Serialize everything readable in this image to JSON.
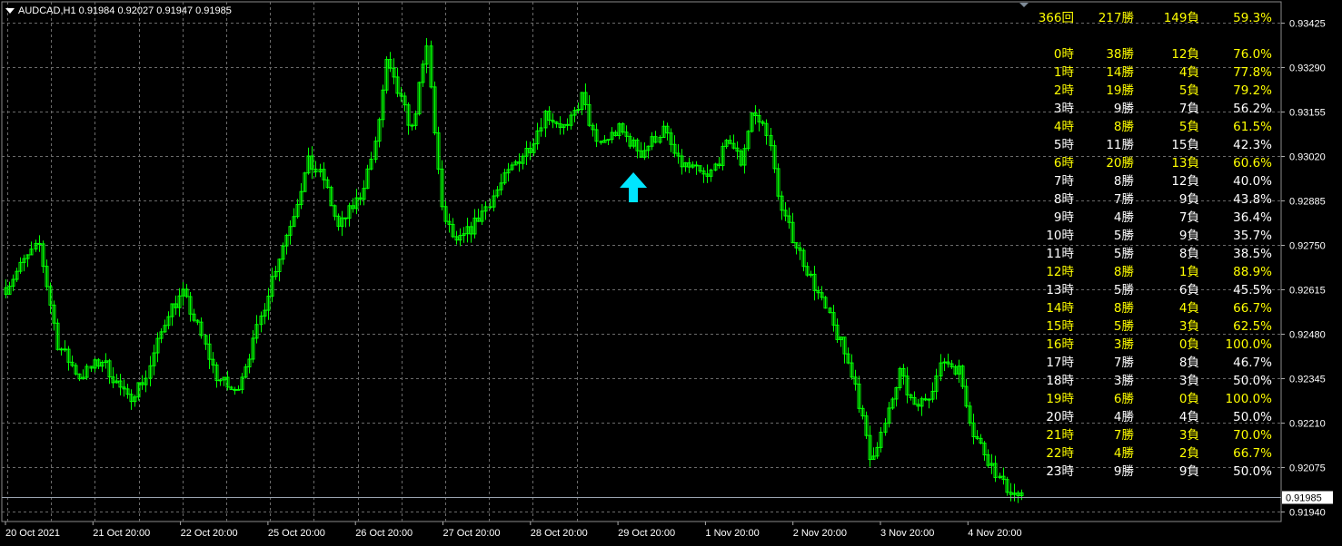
{
  "header": {
    "symbol_timeframe": "AUDCAD,H1",
    "open": "0.91984",
    "high": "0.92027",
    "low": "0.91947",
    "close": "0.91985"
  },
  "colors": {
    "background": "#000000",
    "grid": "#6b6b6b",
    "candle": "#00ff00",
    "axis_text": "#ffffff",
    "highlight_text": "#ffff00",
    "normal_text": "#ffffff",
    "arrow": "#00e5ff",
    "current_price_line": "#9aa3b0"
  },
  "summary": {
    "total": "366回",
    "wins": "217勝",
    "losses": "149負",
    "rate": "59.3%",
    "highlight": true
  },
  "hours": [
    {
      "hour": "0時",
      "wins": "38勝",
      "losses": "12負",
      "rate": "76.0%",
      "highlight": true
    },
    {
      "hour": "1時",
      "wins": "14勝",
      "losses": "4負",
      "rate": "77.8%",
      "highlight": true
    },
    {
      "hour": "2時",
      "wins": "19勝",
      "losses": "5負",
      "rate": "79.2%",
      "highlight": true
    },
    {
      "hour": "3時",
      "wins": "9勝",
      "losses": "7負",
      "rate": "56.2%",
      "highlight": false
    },
    {
      "hour": "4時",
      "wins": "8勝",
      "losses": "5負",
      "rate": "61.5%",
      "highlight": true
    },
    {
      "hour": "5時",
      "wins": "11勝",
      "losses": "15負",
      "rate": "42.3%",
      "highlight": false
    },
    {
      "hour": "6時",
      "wins": "20勝",
      "losses": "13負",
      "rate": "60.6%",
      "highlight": true
    },
    {
      "hour": "7時",
      "wins": "8勝",
      "losses": "12負",
      "rate": "40.0%",
      "highlight": false
    },
    {
      "hour": "8時",
      "wins": "7勝",
      "losses": "9負",
      "rate": "43.8%",
      "highlight": false
    },
    {
      "hour": "9時",
      "wins": "4勝",
      "losses": "7負",
      "rate": "36.4%",
      "highlight": false
    },
    {
      "hour": "10時",
      "wins": "5勝",
      "losses": "9負",
      "rate": "35.7%",
      "highlight": false
    },
    {
      "hour": "11時",
      "wins": "5勝",
      "losses": "8負",
      "rate": "38.5%",
      "highlight": false
    },
    {
      "hour": "12時",
      "wins": "8勝",
      "losses": "1負",
      "rate": "88.9%",
      "highlight": true
    },
    {
      "hour": "13時",
      "wins": "5勝",
      "losses": "6負",
      "rate": "45.5%",
      "highlight": false
    },
    {
      "hour": "14時",
      "wins": "8勝",
      "losses": "4負",
      "rate": "66.7%",
      "highlight": true
    },
    {
      "hour": "15時",
      "wins": "5勝",
      "losses": "3負",
      "rate": "62.5%",
      "highlight": true
    },
    {
      "hour": "16時",
      "wins": "3勝",
      "losses": "0負",
      "rate": "100.0%",
      "highlight": true
    },
    {
      "hour": "17時",
      "wins": "7勝",
      "losses": "8負",
      "rate": "46.7%",
      "highlight": false
    },
    {
      "hour": "18時",
      "wins": "3勝",
      "losses": "3負",
      "rate": "50.0%",
      "highlight": false
    },
    {
      "hour": "19時",
      "wins": "6勝",
      "losses": "0負",
      "rate": "100.0%",
      "highlight": true
    },
    {
      "hour": "20時",
      "wins": "4勝",
      "losses": "4負",
      "rate": "50.0%",
      "highlight": false
    },
    {
      "hour": "21時",
      "wins": "7勝",
      "losses": "3負",
      "rate": "70.0%",
      "highlight": true
    },
    {
      "hour": "22時",
      "wins": "4勝",
      "losses": "2負",
      "rate": "66.7%",
      "highlight": true
    },
    {
      "hour": "23時",
      "wins": "9勝",
      "losses": "9負",
      "rate": "50.0%",
      "highlight": false
    }
  ],
  "chart_data": {
    "type": "candlestick",
    "y_ticks": [
      "0.93425",
      "0.93290",
      "0.93155",
      "0.93020",
      "0.92885",
      "0.92750",
      "0.92615",
      "0.92480",
      "0.92345",
      "0.92210",
      "0.92075",
      "0.91940"
    ],
    "ylim": [
      0.9191,
      0.93455
    ],
    "current_price": "0.91985",
    "x_ticks": [
      "20 Oct 2021",
      "21 Oct 20:00",
      "22 Oct 20:00",
      "25 Oct 20:00",
      "26 Oct 20:00",
      "27 Oct 20:00",
      "28 Oct 20:00",
      "29 Oct 20:00",
      "1 Nov 20:00",
      "2 Nov 20:00",
      "3 Nov 20:00",
      "4 Nov 20:00"
    ],
    "grid": true,
    "bar_count": 276,
    "price_path": [
      [
        0,
        0.9262
      ],
      [
        5,
        0.927
      ],
      [
        9,
        0.9275
      ],
      [
        14,
        0.9245
      ],
      [
        20,
        0.9235
      ],
      [
        26,
        0.924
      ],
      [
        33,
        0.9228
      ],
      [
        38,
        0.9235
      ],
      [
        44,
        0.9255
      ],
      [
        48,
        0.926
      ],
      [
        52,
        0.925
      ],
      [
        57,
        0.9235
      ],
      [
        62,
        0.923
      ],
      [
        67,
        0.9245
      ],
      [
        72,
        0.9265
      ],
      [
        78,
        0.9285
      ],
      [
        82,
        0.93
      ],
      [
        86,
        0.9295
      ],
      [
        90,
        0.928
      ],
      [
        96,
        0.929
      ],
      [
        100,
        0.9305
      ],
      [
        103,
        0.933
      ],
      [
        110,
        0.931
      ],
      [
        114,
        0.9335
      ],
      [
        118,
        0.9285
      ],
      [
        122,
        0.9275
      ],
      [
        126,
        0.928
      ],
      [
        132,
        0.929
      ],
      [
        138,
        0.93
      ],
      [
        142,
        0.9305
      ],
      [
        146,
        0.9315
      ],
      [
        152,
        0.931
      ],
      [
        156,
        0.932
      ],
      [
        160,
        0.9305
      ],
      [
        166,
        0.931
      ],
      [
        172,
        0.9303
      ],
      [
        178,
        0.931
      ],
      [
        182,
        0.93
      ],
      [
        186,
        0.9298
      ],
      [
        190,
        0.9295
      ],
      [
        196,
        0.9307
      ],
      [
        199,
        0.93
      ],
      [
        202,
        0.9315
      ],
      [
        206,
        0.931
      ],
      [
        210,
        0.9285
      ],
      [
        214,
        0.9275
      ],
      [
        218,
        0.9265
      ],
      [
        222,
        0.9255
      ],
      [
        226,
        0.9245
      ],
      [
        230,
        0.9233
      ],
      [
        234,
        0.921
      ],
      [
        238,
        0.922
      ],
      [
        242,
        0.9236
      ],
      [
        246,
        0.9225
      ],
      [
        250,
        0.923
      ],
      [
        254,
        0.924
      ],
      [
        258,
        0.9237
      ],
      [
        262,
        0.9218
      ],
      [
        266,
        0.921
      ],
      [
        270,
        0.9202
      ],
      [
        275,
        0.9198
      ]
    ],
    "signal_arrow": {
      "bar": 170,
      "direction": "up"
    }
  }
}
